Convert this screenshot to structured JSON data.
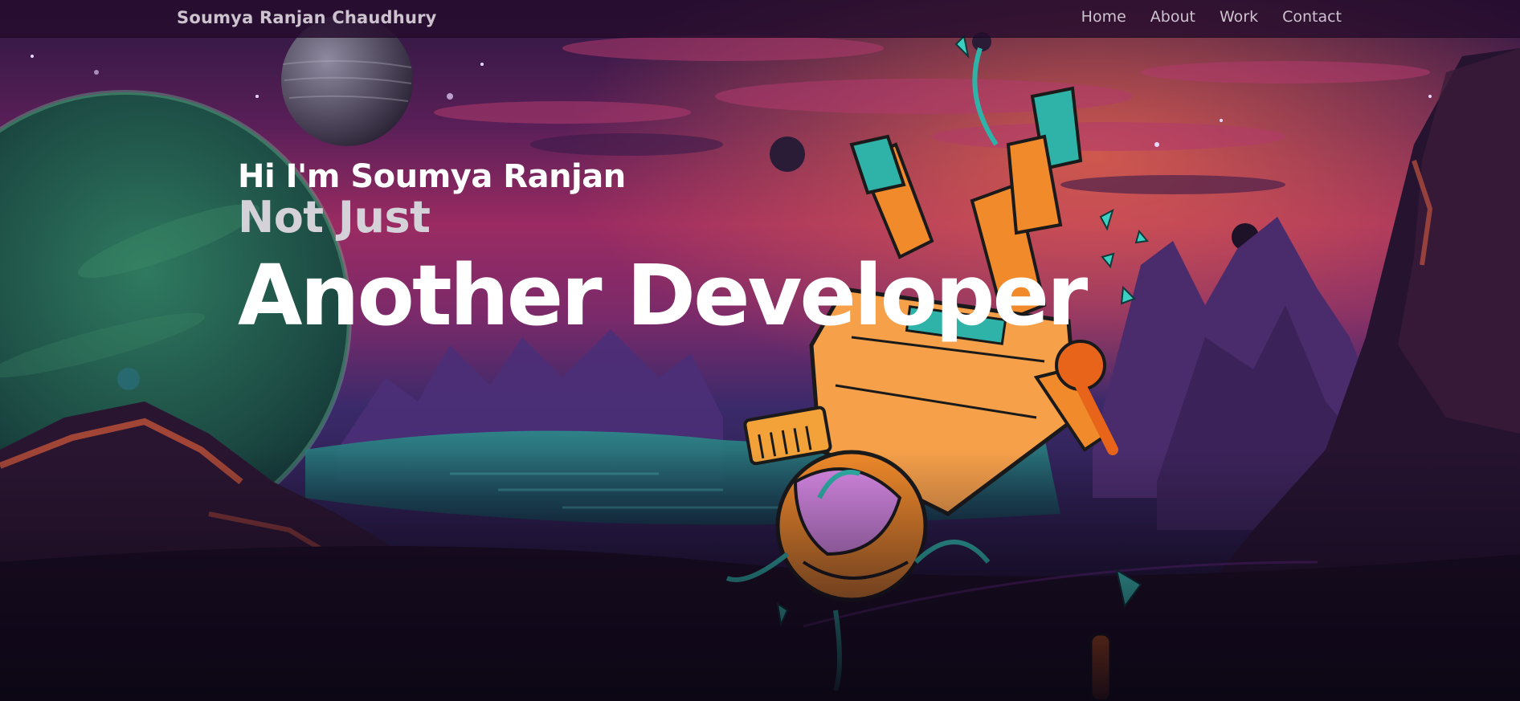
{
  "nav": {
    "brand": "Soumya Ranjan Chaudhury",
    "links": [
      {
        "label": "Home"
      },
      {
        "label": "About"
      },
      {
        "label": "Work"
      },
      {
        "label": "Contact"
      }
    ]
  },
  "hero": {
    "greeting": "Hi I'm Soumya Ranjan",
    "subtitle": "Not Just",
    "title": "Another Developer"
  },
  "colors": {
    "nav_background": "#260c2d",
    "nav_text": "#cdc3cf",
    "hero_text": "#ffffff",
    "subtitle_text": "#d4d2d8",
    "sky_top": "#2a1740",
    "sky_mid": "#8a2a63",
    "astronaut_suit": "#f08a2a",
    "astronaut_trim": "#2fb3a8",
    "planet_green": "#1f5a4a"
  },
  "background": {
    "illustration": "astronaut-falling-alien-landscape"
  }
}
